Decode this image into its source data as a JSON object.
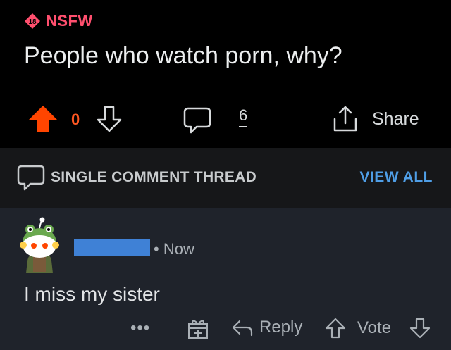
{
  "post": {
    "nsfw_badge_number": "18",
    "nsfw_label": "NSFW",
    "title": "People who watch porn, why?",
    "vote_count": "0",
    "comment_count": "6",
    "share_label": "Share"
  },
  "thread": {
    "label": "SINGLE COMMENT THREAD",
    "view_all": "VIEW ALL"
  },
  "comment": {
    "time": "Now",
    "separator": "•",
    "text": "I miss my sister",
    "more": "•••",
    "reply_label": "Reply",
    "vote_label": "Vote"
  },
  "colors": {
    "upvote": "#ff4500",
    "vote_count": "#ff5722",
    "nsfw": "#ff4f6e",
    "view_all": "#4f9ee6",
    "username_redaction": "#3f81d6",
    "comment_bg": "#1f232b"
  }
}
